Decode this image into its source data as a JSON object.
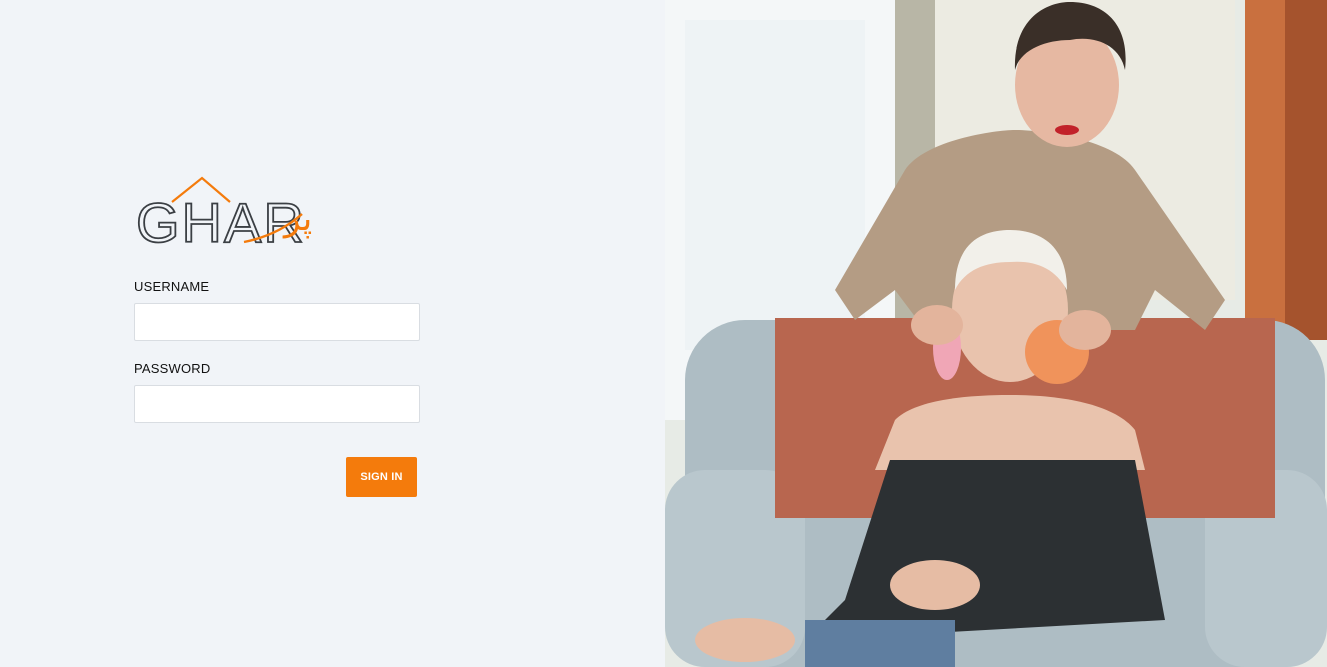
{
  "brand": {
    "logo_text": "GHAR",
    "logo_script": "پر",
    "accent_color": "#f47b0c",
    "text_color": "#3b3f44"
  },
  "login_form": {
    "username_label": "USERNAME",
    "username_value": "",
    "password_label": "PASSWORD",
    "password_value": "",
    "sign_in_label": "SIGN IN"
  },
  "colors": {
    "left_background": "#f1f4f8",
    "button_background": "#f47b0c",
    "input_border": "#d9dde2"
  },
  "hero_image": {
    "description_icon": "photo-beautician-facial-treatment"
  }
}
